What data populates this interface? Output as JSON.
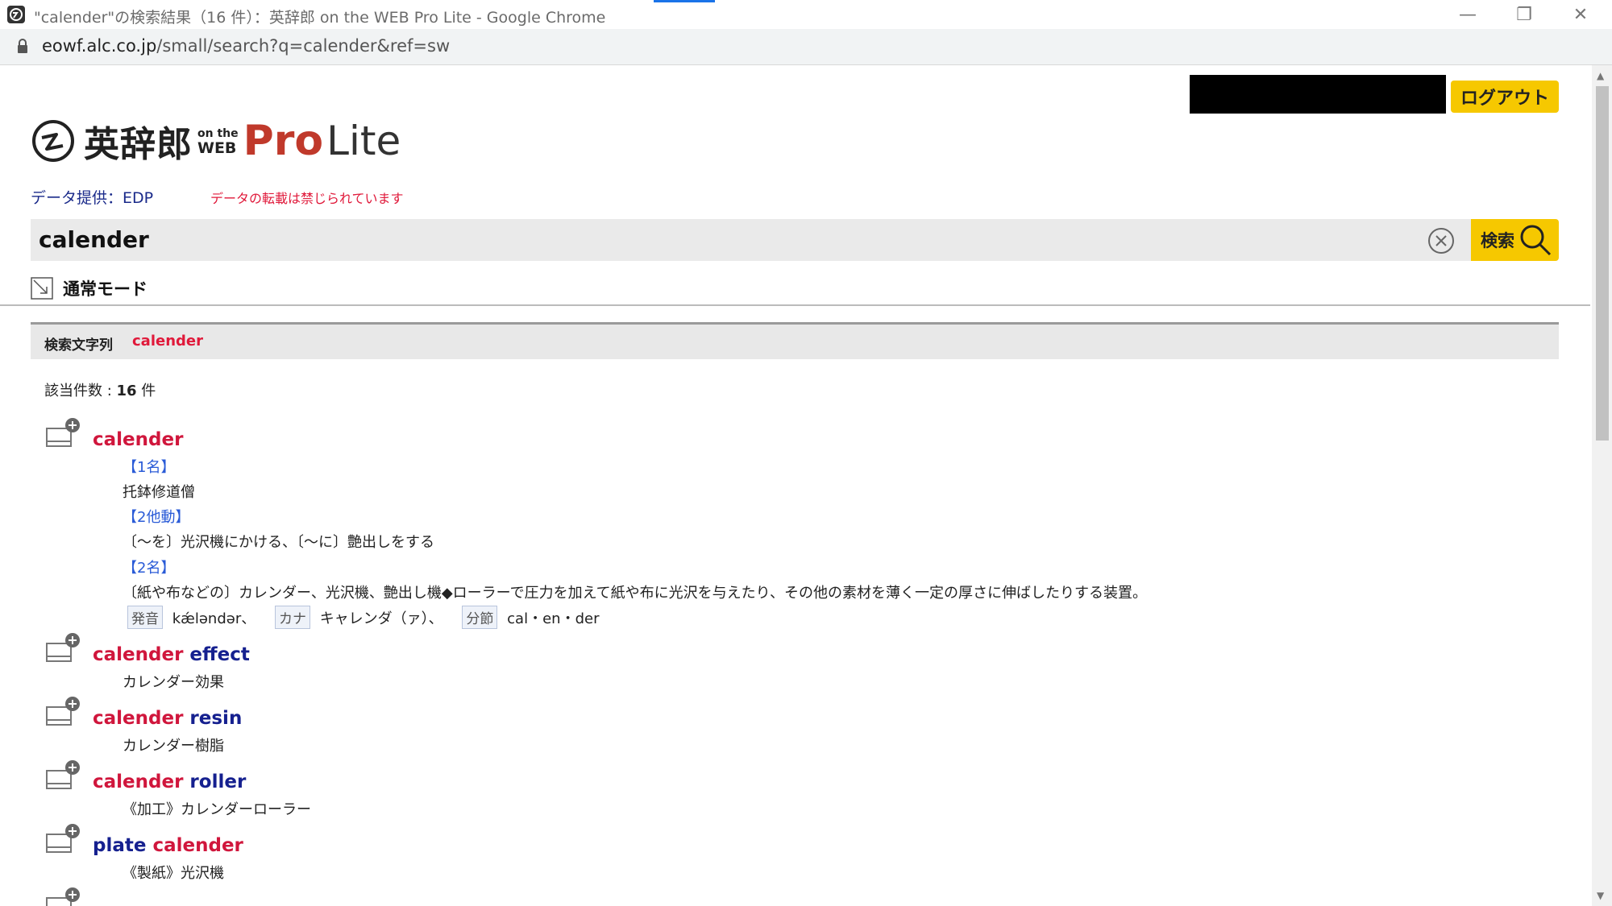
{
  "browser": {
    "window_title": "\"calender\"の検索結果（16 件）：英辞郎 on the WEB Pro Lite - Google Chrome",
    "url_host": "eowf.alc.co.jp",
    "url_path": "/small/search?q=calender&ref=sw",
    "controls": {
      "minimize": "—",
      "restore": "❐",
      "close": "✕"
    }
  },
  "header": {
    "logout_label": "ログアウト",
    "logo": {
      "kanji": "英辞郎",
      "on_the": "on the",
      "web": "WEB",
      "pro": "Pro",
      "lite": "Lite"
    },
    "provider": "データ提供：EDP",
    "notice": "データの転載は禁じられています"
  },
  "search": {
    "query": "calender",
    "button_label": "検索",
    "mode_label": "通常モード"
  },
  "results": {
    "term_label": "検索文字列",
    "term": "calender",
    "count_label": "該当件数 : ",
    "count": "16",
    "count_unit": " 件",
    "entries": [
      {
        "head_parts": [
          {
            "text": "calender",
            "color": "red"
          }
        ],
        "senses": [
          {
            "pos": "【1名】",
            "def": "托鉢修道僧"
          },
          {
            "pos": "【2他動】",
            "def": "〔～を〕光沢機にかける、〔～に〕艶出しをする"
          },
          {
            "pos": "【2名】",
            "def": "〔紙や布などの〕カレンダー、光沢機、艶出し機◆ローラーで圧力を加えて紙や布に光沢を与えたり、その他の素材を薄く一定の厚さに伸ばしたりする装置。"
          }
        ],
        "pron": {
          "tag1": "発音",
          "val1": "kǽləndər、",
          "tag2": "カナ",
          "val2": "キャレンダ（ァ）、",
          "tag3": "分節",
          "val3": "cal・en・der"
        }
      },
      {
        "head_parts": [
          {
            "text": "calender",
            "color": "red"
          },
          {
            "text": " effect",
            "color": "navy"
          }
        ],
        "def": "カレンダー効果"
      },
      {
        "head_parts": [
          {
            "text": "calender",
            "color": "red"
          },
          {
            "text": " resin",
            "color": "navy"
          }
        ],
        "def": "カレンダー樹脂"
      },
      {
        "head_parts": [
          {
            "text": "calender",
            "color": "red"
          },
          {
            "text": " roller",
            "color": "navy"
          }
        ],
        "def": "《加工》カレンダーローラー"
      },
      {
        "head_parts": [
          {
            "text": "plate",
            "color": "navy"
          },
          {
            "text": " calender",
            "color": "red"
          }
        ],
        "def": "《製紙》光沢機"
      }
    ]
  }
}
